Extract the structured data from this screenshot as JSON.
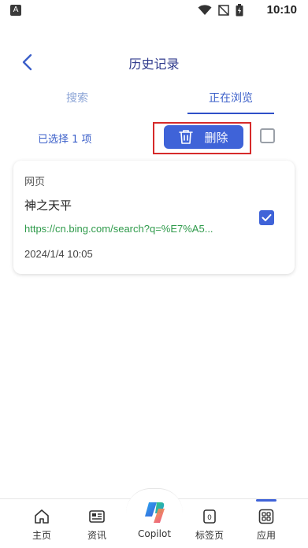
{
  "status_bar": {
    "time": "10:10",
    "app_icon_letter": "A"
  },
  "header": {
    "title": "历史记录"
  },
  "tabs": [
    {
      "label": "搜索",
      "active": false
    },
    {
      "label": "正在浏览",
      "active": true
    }
  ],
  "selection": {
    "count_text": "已选择 1 项",
    "delete_label": "删除",
    "select_all_checked": false
  },
  "history_items": [
    {
      "category": "网页",
      "title": "神之天平",
      "url": "https://cn.bing.com/search?q=%E7%A5...",
      "time": "2024/1/4 10:05",
      "checked": true
    }
  ],
  "bottom_nav": [
    {
      "label": "主页",
      "icon": "home-icon"
    },
    {
      "label": "资讯",
      "icon": "news-icon"
    },
    {
      "label": "Copilot",
      "icon": "copilot-icon"
    },
    {
      "label": "标签页",
      "icon": "tabs-icon",
      "badge": "0"
    },
    {
      "label": "应用",
      "icon": "apps-icon",
      "active": true
    }
  ],
  "colors": {
    "accent": "#3f63d8",
    "url_green": "#2e9a4a",
    "annotation_red": "#d62a2a"
  }
}
